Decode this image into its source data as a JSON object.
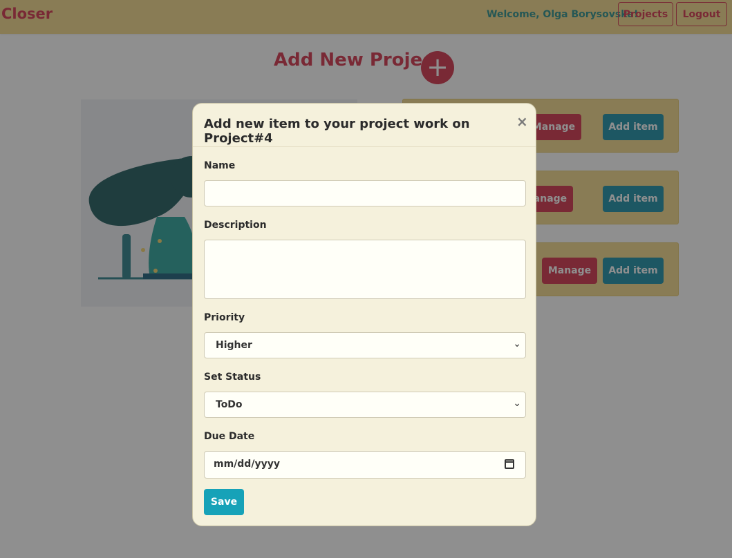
{
  "navbar": {
    "brand": "Closer",
    "welcome": "Welcome, Olga Borysovska!",
    "projects_label": "Projects",
    "logout_label": "Logout"
  },
  "page": {
    "title": "Add New Project",
    "add_icon": "plus-circle-icon"
  },
  "project_cards": [
    {
      "manage_label": "Manage",
      "add_label": "Add item"
    },
    {
      "manage_label": "Manage",
      "add_label": "Add item"
    },
    {
      "manage_label": "Manage",
      "add_label": "Add item"
    }
  ],
  "modal": {
    "title": "Add new item to your project work on Project#4",
    "close_glyph": "×",
    "name_label": "Name",
    "name_value": "",
    "description_label": "Description",
    "description_value": "",
    "priority_label": "Priority",
    "priority_value": "Higher",
    "status_label": "Set Status",
    "status_value": "ToDo",
    "due_label": "Due Date",
    "due_placeholder": "mm/dd/yyyy",
    "save_label": "Save"
  },
  "colors": {
    "brand": "#d2334a",
    "navbar_bg": "#f3d88a",
    "teal": "#1b8fa6",
    "modal_bg": "#f5f1dc"
  }
}
